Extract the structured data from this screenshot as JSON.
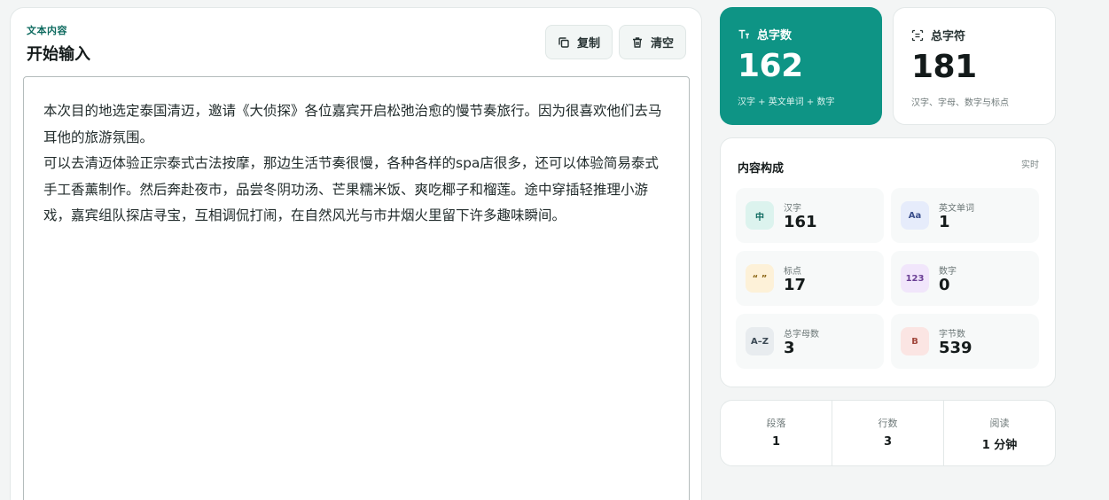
{
  "editor": {
    "eyebrow": "文本内容",
    "title": "开始输入",
    "copy_label": "复制",
    "clear_label": "清空",
    "text": "本次目的地选定泰国清迈，邀请《大侦探》各位嘉宾开启松弛治愈的慢节奏旅行。因为很喜欢他们去马耳他的旅游氛围。\n可以去清迈体验正宗泰式古法按摩，那边生活节奏很慢，各种各样的spa店很多，还可以体验简易泰式手工香薰制作。然后奔赴夜市，品尝冬阴功汤、芒果糯米饭、爽吃椰子和榴莲。途中穿插轻推理小游戏，嘉宾组队探店寻宝，互相调侃打闹，在自然风光与市井烟火里留下许多趣味瞬间。"
  },
  "stats": {
    "total_words": {
      "label": "总字数",
      "value": "162",
      "sub": "汉字 + 英文单词 + 数字"
    },
    "total_chars": {
      "label": "总字符",
      "value": "181",
      "sub": "汉字、字母、数字与标点"
    }
  },
  "composition": {
    "title": "内容构成",
    "badge": "实时",
    "items": [
      {
        "icon": "中",
        "label": "汉字",
        "value": "161"
      },
      {
        "icon": "Aa",
        "label": "英文单词",
        "value": "1"
      },
      {
        "icon": "“ ”",
        "label": "标点",
        "value": "17"
      },
      {
        "icon": "123",
        "label": "数字",
        "value": "0"
      },
      {
        "icon": "A–Z",
        "label": "总字母数",
        "value": "3"
      },
      {
        "icon": "B",
        "label": "字节数",
        "value": "539"
      }
    ]
  },
  "summary": [
    {
      "label": "段落",
      "value": "1"
    },
    {
      "label": "行数",
      "value": "3"
    },
    {
      "label": "阅读",
      "value": "1 分钟"
    }
  ],
  "colors": {
    "accent": "#0e9485",
    "chinese_icon_bg": "#dcf3ee",
    "english_icon_bg": "#e6ecfb",
    "punct_icon_bg": "#fdf1d8",
    "number_icon_bg": "#f1e6fb",
    "letters_icon_bg": "#e8ecef",
    "bytes_icon_bg": "#fbe5e3"
  },
  "icons": {
    "copy": "copy-icon",
    "clear": "trash-icon",
    "total_words": "text-size-icon",
    "total_chars": "scan-text-icon"
  }
}
